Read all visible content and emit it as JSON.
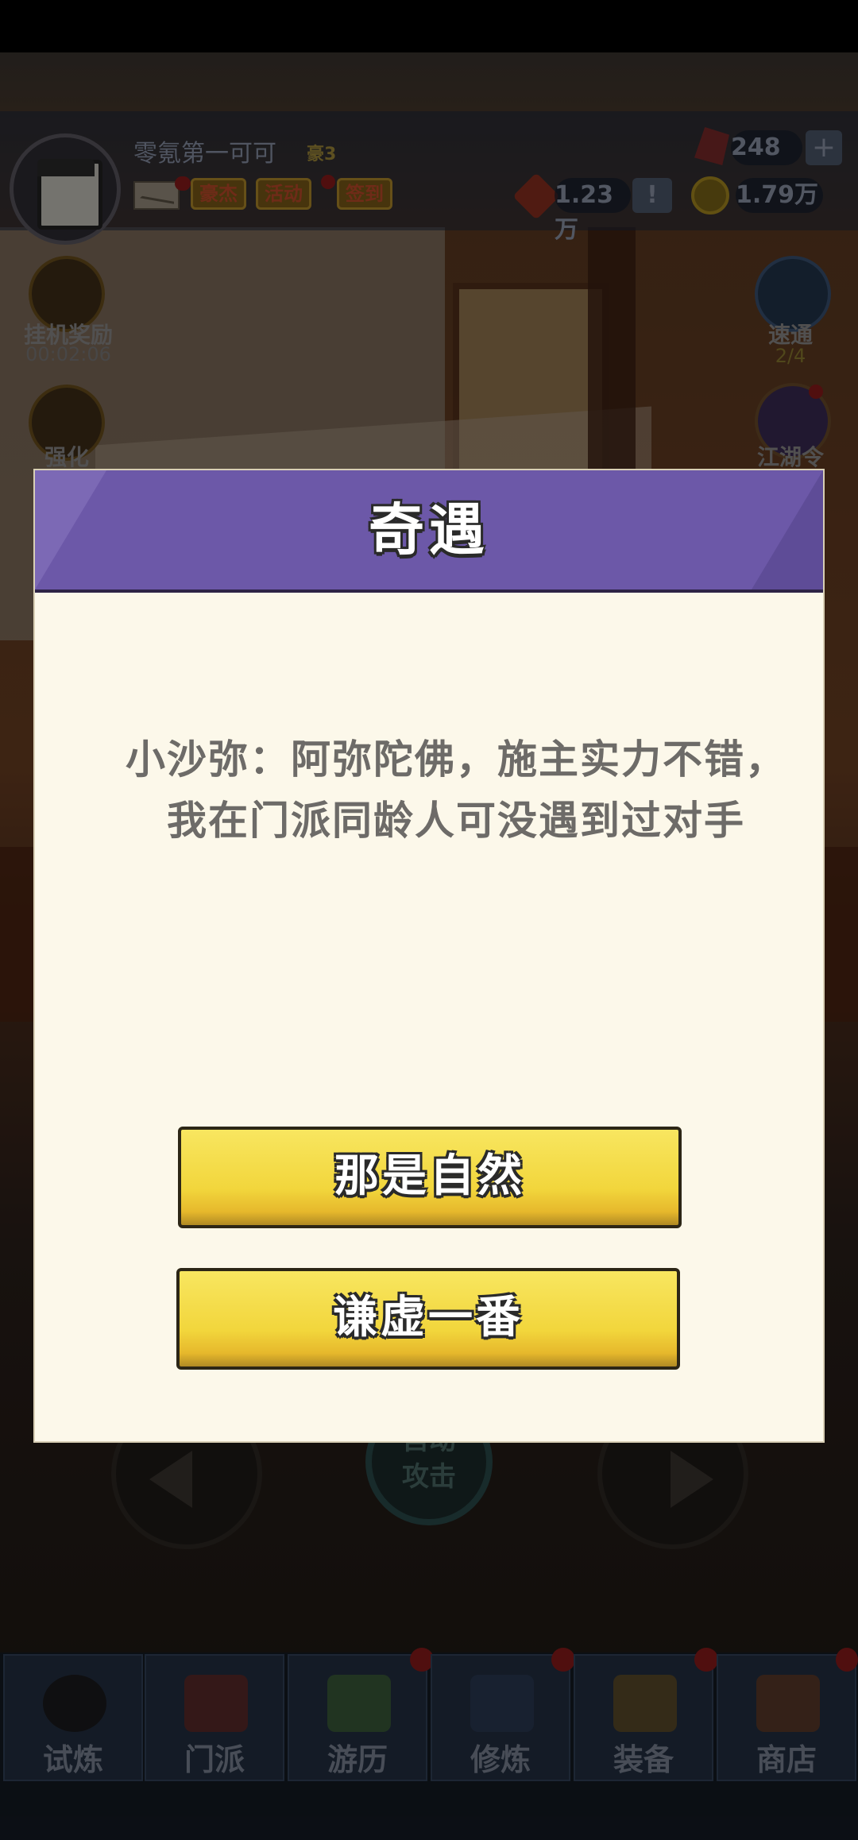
{
  "player": {
    "name": "零氪第一可可",
    "level": "豪3",
    "avatar_icon": "treasure-chest-avatar"
  },
  "header_buttons": [
    {
      "label": "豪杰",
      "badge": true
    },
    {
      "label": "活动",
      "badge": false
    },
    {
      "label": "签到",
      "badge": true
    }
  ],
  "resources": {
    "gems": "248",
    "tokens": "1.23万",
    "gold": "1.79万",
    "plus_label": "+",
    "alert_label": "!"
  },
  "left_side": {
    "idle_reward_label": "挂机奖励",
    "idle_timer": "00:02:06",
    "enhance_label": "强化"
  },
  "right_side": {
    "wanted_label": "速通",
    "wanted_progress": "2/4",
    "jianghu_label": "江湖令"
  },
  "controls": {
    "auto_attack_label": "自动\n攻击"
  },
  "bottom_nav": [
    {
      "label": "试炼",
      "icon": "ninja-icon",
      "badge": false
    },
    {
      "label": "门派",
      "icon": "temple-icon",
      "badge": false
    },
    {
      "label": "游历",
      "icon": "landscape-icon",
      "badge": true
    },
    {
      "label": "修炼",
      "icon": "scroll-book-icon",
      "badge": true
    },
    {
      "label": "装备",
      "icon": "sword-icon",
      "badge": true
    },
    {
      "label": "商店",
      "icon": "shop-icon",
      "badge": true
    }
  ],
  "dialog": {
    "title": "奇遇",
    "message": "小沙弥：阿弥陀佛，施主实力不错，我在门派同龄人可没遇到过对手",
    "choices": [
      "那是自然",
      "谦虚一番"
    ]
  },
  "colors": {
    "dialog_header": "#6c58a8",
    "dialog_body": "#fcf8ea",
    "choice_button": "#f2d63c",
    "message_text": "#6d6b68"
  }
}
